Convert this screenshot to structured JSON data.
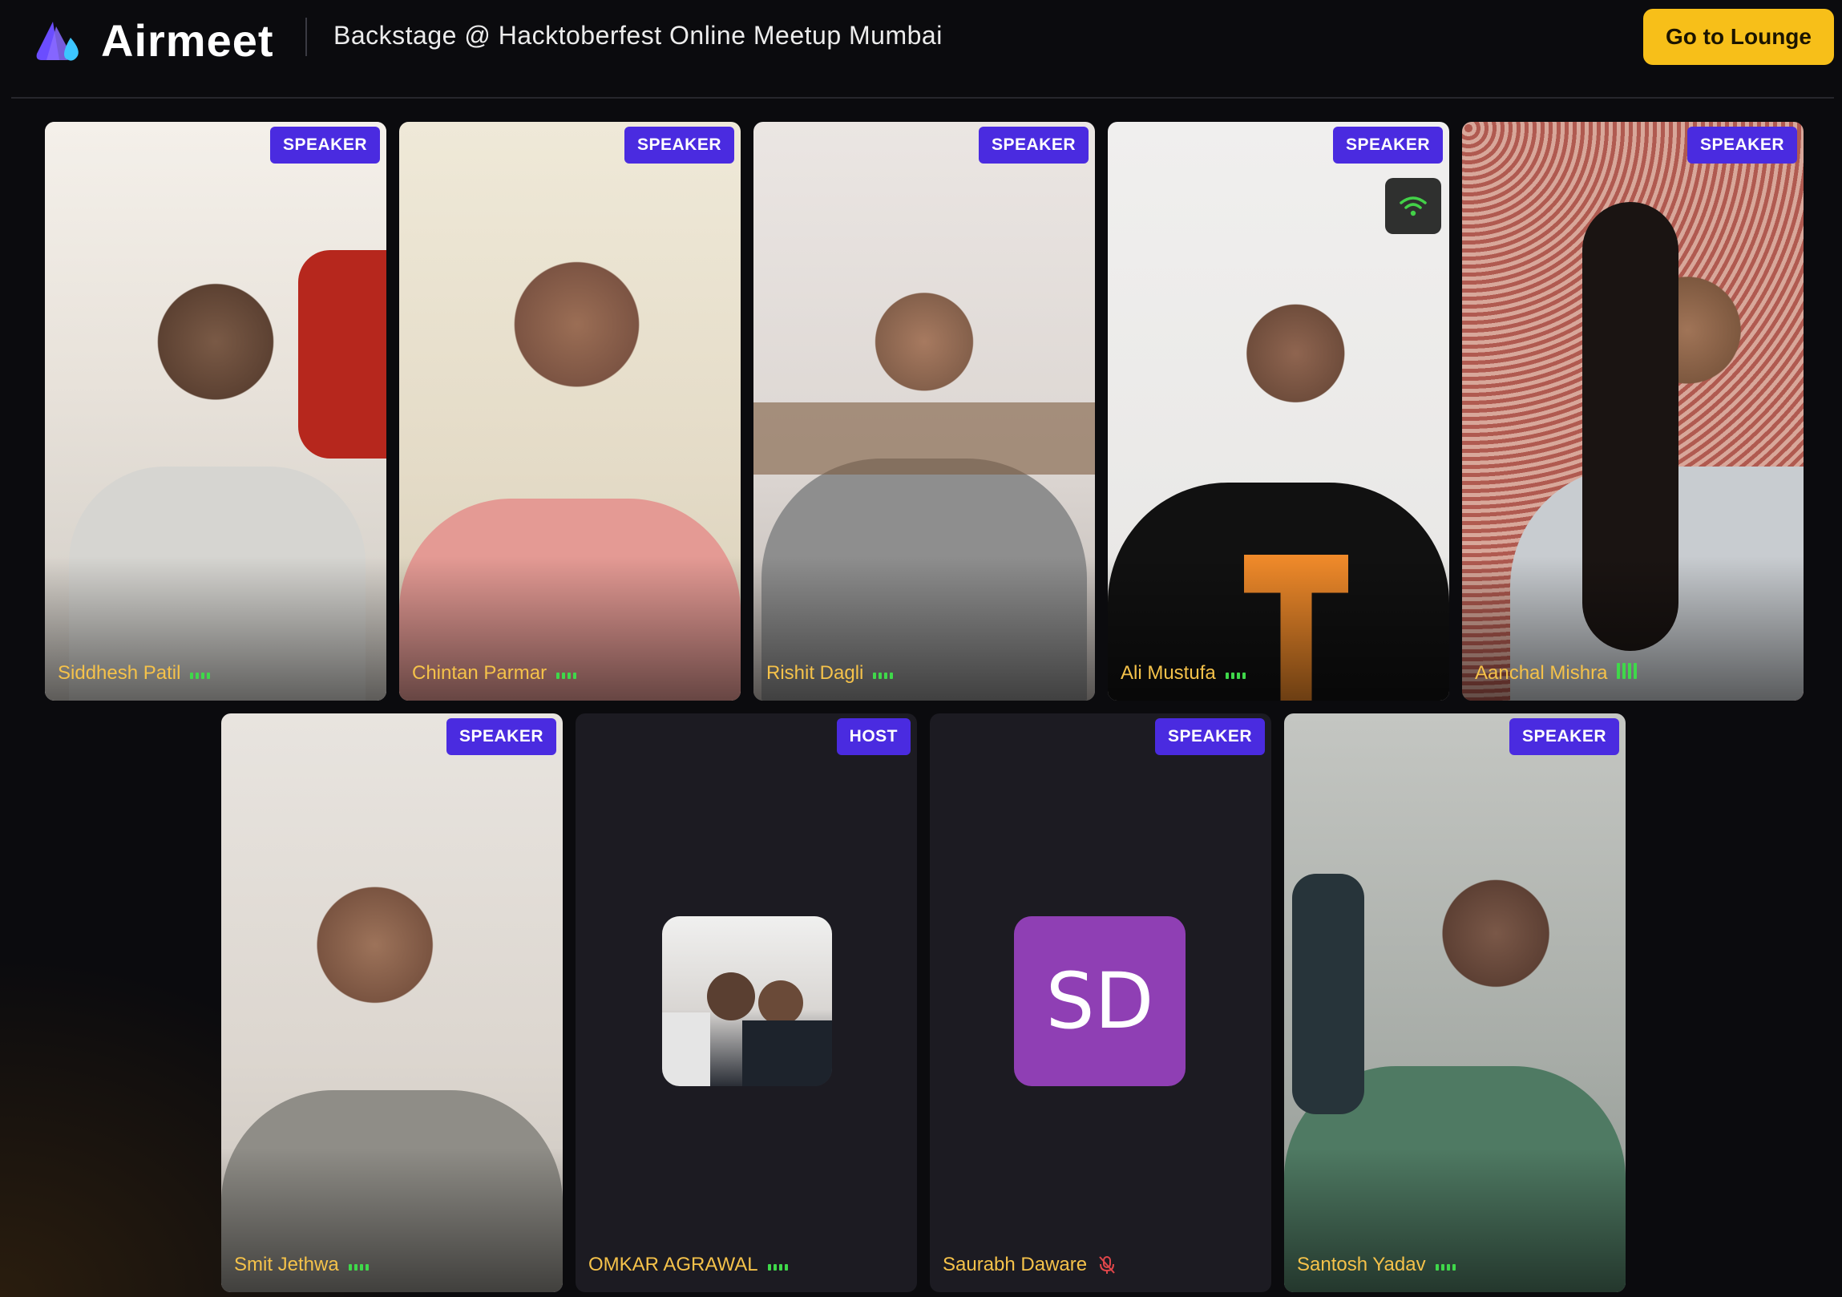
{
  "app": {
    "name": "Airmeet",
    "brand_color": "#6b4dff"
  },
  "header": {
    "event_title": "Backstage @ Hacktoberfest Online Meetup Mumbai",
    "lounge_button": "Go to Lounge",
    "lounge_color": "#f7bf19"
  },
  "participants": [
    {
      "name": "Siddhesh Patil",
      "role": "SPEAKER",
      "audio": "speaking-low",
      "view": "video"
    },
    {
      "name": "Chintan Parmar",
      "role": "SPEAKER",
      "audio": "speaking-low",
      "view": "video"
    },
    {
      "name": "Rishit Dagli",
      "role": "SPEAKER",
      "audio": "speaking-low",
      "view": "video"
    },
    {
      "name": "Ali Mustufa",
      "role": "SPEAKER",
      "audio": "speaking-low",
      "view": "video",
      "network_icon": "wifi-icon"
    },
    {
      "name": "Aanchal Mishra",
      "role": "SPEAKER",
      "audio": "speaking-high",
      "view": "video"
    },
    {
      "name": "Smit Jethwa",
      "role": "SPEAKER",
      "audio": "speaking-low",
      "view": "video"
    },
    {
      "name": "OMKAR AGRAWAL",
      "role": "HOST",
      "audio": "speaking-low",
      "view": "profile-photo"
    },
    {
      "name": "Saurabh Daware",
      "role": "SPEAKER",
      "audio": "muted",
      "view": "initials",
      "initials": "SD",
      "avatar_color": "#8f3fb4"
    },
    {
      "name": "Santosh Yadav",
      "role": "SPEAKER",
      "audio": "speaking-low",
      "view": "video"
    }
  ],
  "colors": {
    "role_badge": "#4a2be0",
    "name_text": "#f5c24a",
    "audio_level": "#3fd84a"
  }
}
